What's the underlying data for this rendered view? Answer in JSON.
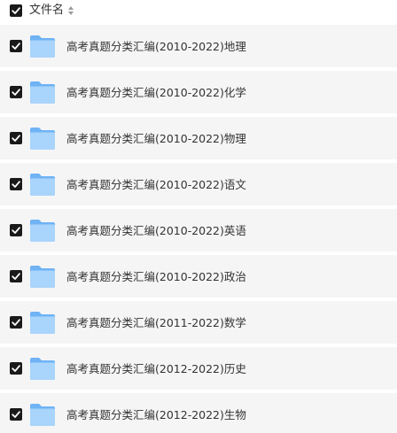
{
  "header": {
    "column_label": "文件名",
    "sort_icon": "sort-updown-icon"
  },
  "colors": {
    "row_background": "#f5f5f6",
    "checkbox": "#1a1a1a",
    "folder_light": "#a9d4fb",
    "folder_dark": "#6fb3f5",
    "text": "#333333"
  },
  "rows": [
    {
      "name": "高考真题分类汇编(2010-2022)地理",
      "checked": true
    },
    {
      "name": "高考真题分类汇编(2010-2022)化学",
      "checked": true
    },
    {
      "name": "高考真题分类汇编(2010-2022)物理",
      "checked": true
    },
    {
      "name": "高考真题分类汇编(2010-2022)语文",
      "checked": true
    },
    {
      "name": "高考真题分类汇编(2010-2022)英语",
      "checked": true
    },
    {
      "name": "高考真题分类汇编(2010-2022)政治",
      "checked": true
    },
    {
      "name": "高考真题分类汇编(2011-2022)数学",
      "checked": true
    },
    {
      "name": "高考真题分类汇编(2012-2022)历史",
      "checked": true
    },
    {
      "name": "高考真题分类汇编(2012-2022)生物",
      "checked": true
    }
  ]
}
